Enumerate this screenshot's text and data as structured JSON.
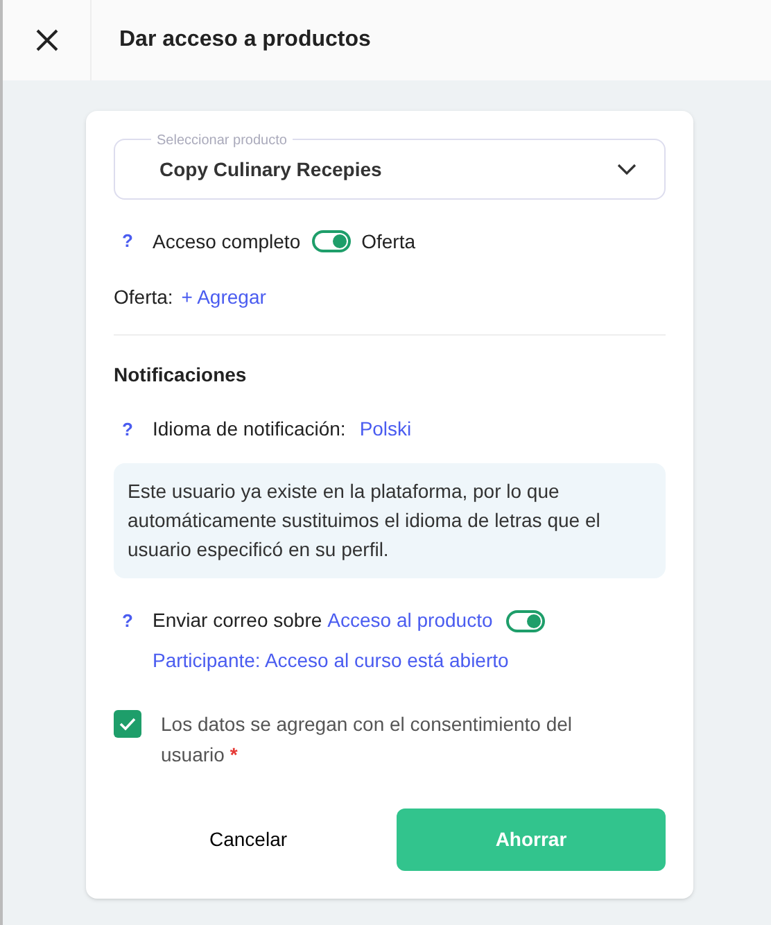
{
  "header": {
    "title": "Dar acceso a productos"
  },
  "product_select": {
    "label": "Seleccionar producto",
    "value": "Copy Culinary Recepies"
  },
  "full_access": {
    "help": "?",
    "label": "Acceso completo",
    "on": true,
    "toggle_label": "Oferta"
  },
  "offer": {
    "label": "Oferta:",
    "link": "+ Agregar"
  },
  "notifications": {
    "heading": "Notificaciones",
    "help": "?",
    "language_label": "Idioma de notificación:",
    "language": "Polski",
    "info": "Este usuario ya existe en la plataforma, por lo que automáticamente sustituimos el idioma de letras que el usuario especificó en su perfil.",
    "email": {
      "help": "?",
      "label": "Enviar correo sobre",
      "link": "Acceso al producto",
      "on": true,
      "template": "Participante: Acceso al curso está abierto"
    }
  },
  "consent": {
    "checked": true,
    "label": "Los datos se agregan con el consentimiento del usuario",
    "required_mark": "*"
  },
  "buttons": [
    {
      "kind": "secondary",
      "label": "Cancelar"
    },
    {
      "kind": "primary",
      "label": "Ahorrar"
    }
  ]
}
